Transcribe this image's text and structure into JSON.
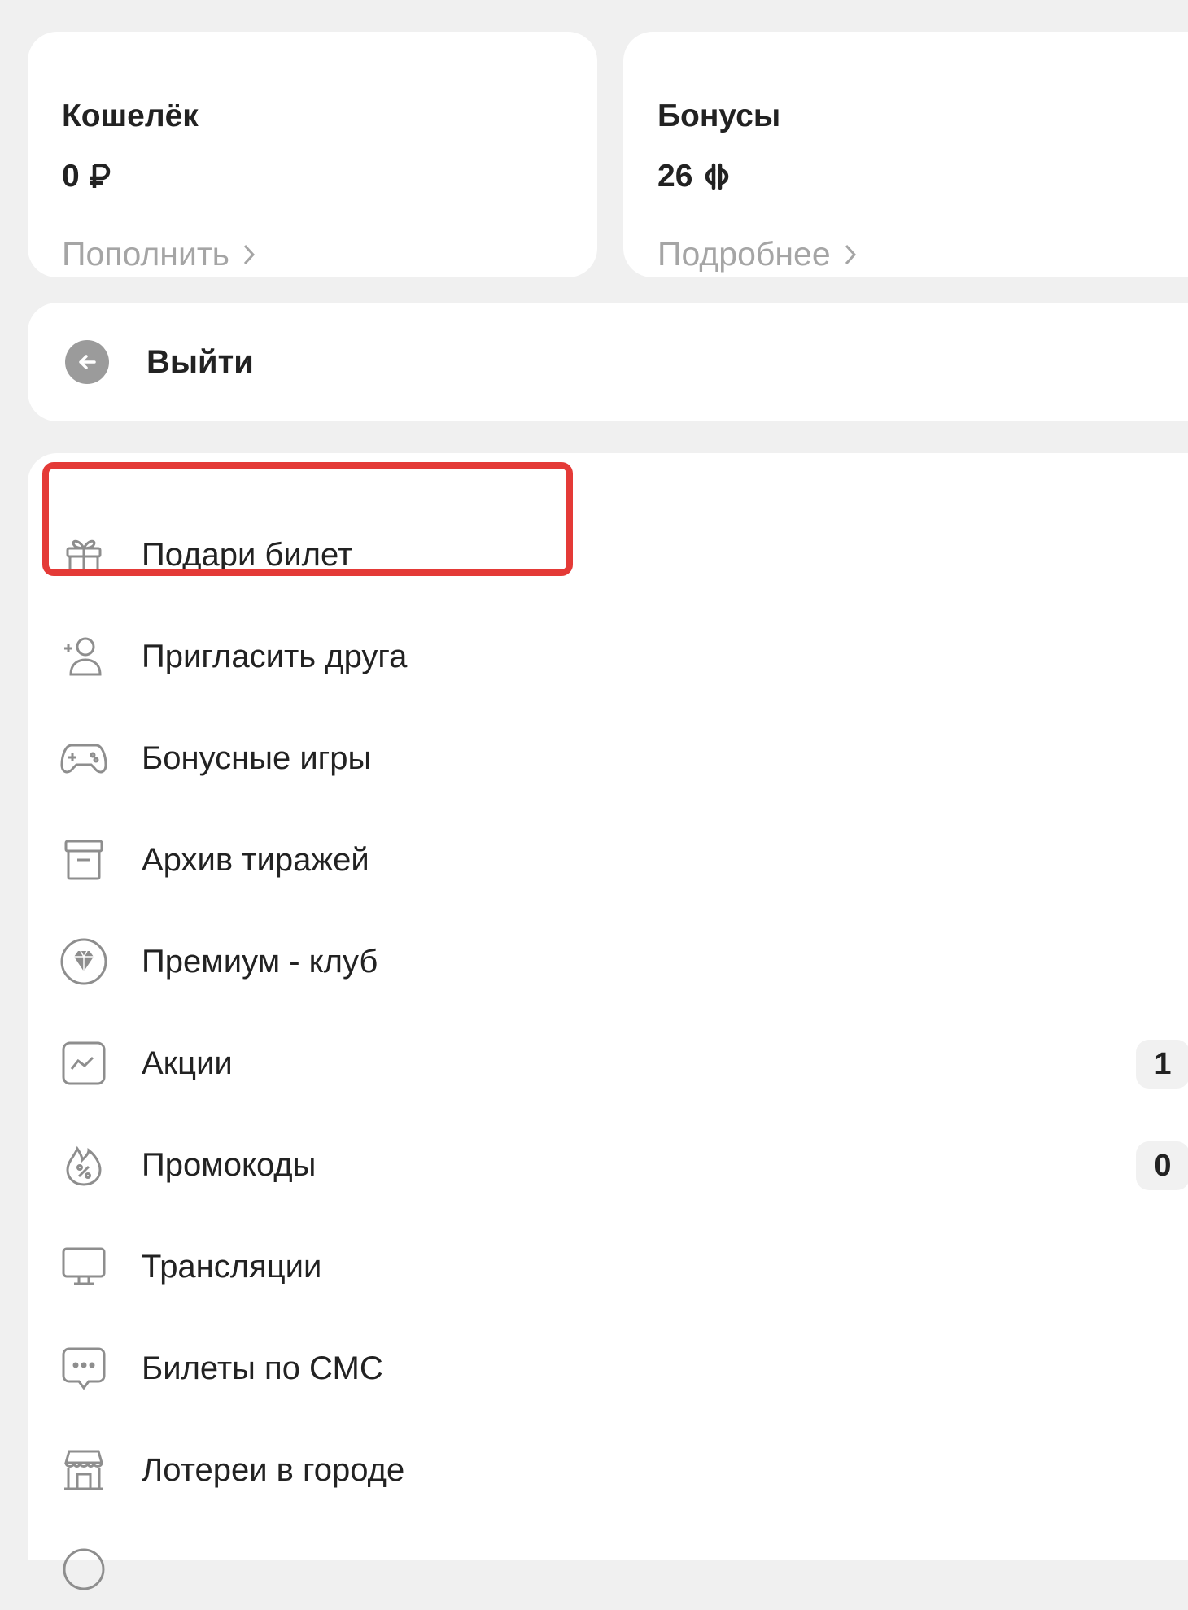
{
  "wallet": {
    "title": "Кошелёк",
    "amount": "0",
    "currency_icon": "ruble-icon",
    "link_label": "Пополнить"
  },
  "bonuses": {
    "title": "Бонусы",
    "amount": "26",
    "currency_icon": "bonus-coin-icon",
    "link_label": "Подробнее"
  },
  "logout": {
    "label": "Выйти",
    "icon": "arrow-left-circle-icon"
  },
  "menu": {
    "items": [
      {
        "label": "Подари билет",
        "icon": "gift-icon",
        "highlighted": true
      },
      {
        "label": "Пригласить друга",
        "icon": "add-user-icon"
      },
      {
        "label": "Бонусные игры",
        "icon": "gamepad-icon"
      },
      {
        "label": "Архив тиражей",
        "icon": "archive-box-icon"
      },
      {
        "label": "Премиум - клуб",
        "icon": "diamond-circle-icon"
      },
      {
        "label": "Акции",
        "icon": "promo-chart-icon",
        "badge": "1"
      },
      {
        "label": "Промокоды",
        "icon": "discount-flame-icon",
        "badge": "0"
      },
      {
        "label": "Трансляции",
        "icon": "monitor-icon"
      },
      {
        "label": "Билеты по СМС",
        "icon": "chat-bubble-icon"
      },
      {
        "label": "Лотереи в городе",
        "icon": "store-icon"
      }
    ]
  },
  "colors": {
    "background": "#f0f0f0",
    "card": "#ffffff",
    "text": "#222222",
    "muted": "#a5a5a5",
    "highlight": "#e43a37",
    "badge_bg": "#f1f1f1"
  }
}
